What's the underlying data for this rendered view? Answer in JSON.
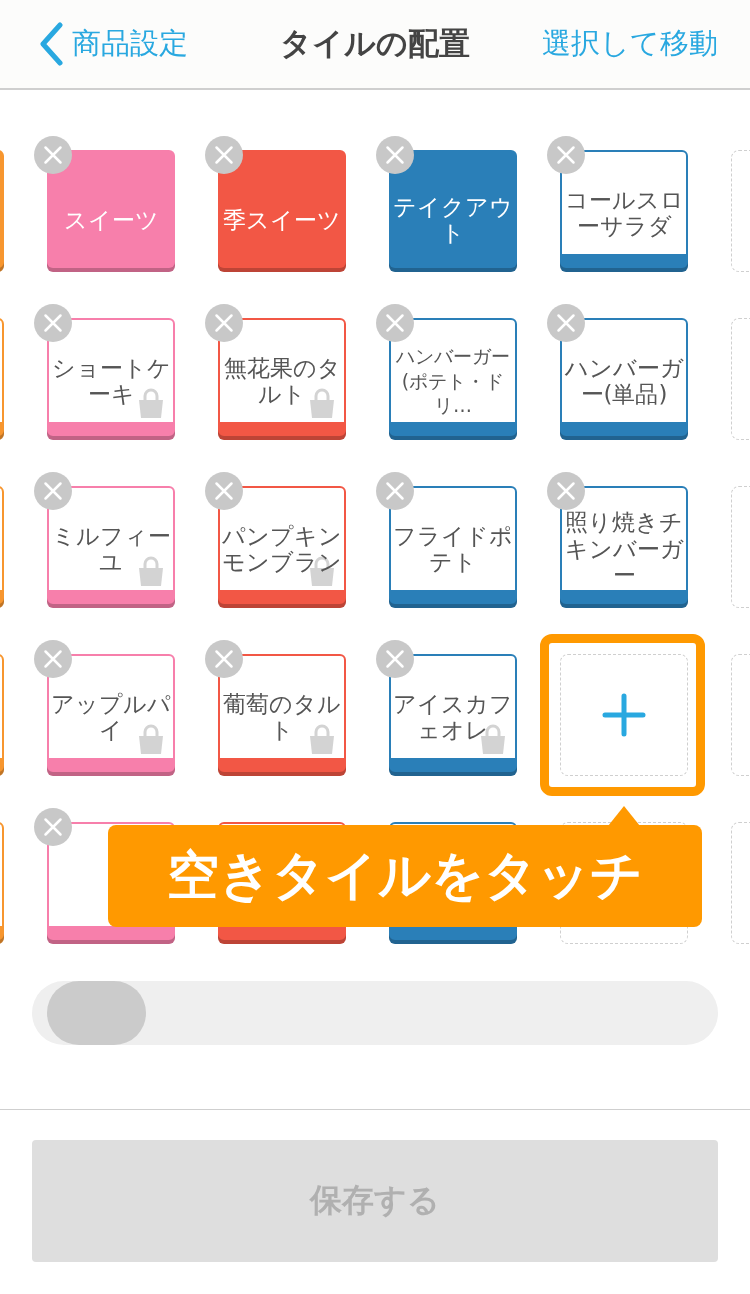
{
  "header": {
    "back_label": "商品設定",
    "title": "タイルの配置",
    "action": "選択して移動"
  },
  "rows": [
    {
      "tiles": [
        {
          "kind": "category",
          "color": "#f7962f",
          "removable": false
        },
        {
          "kind": "category",
          "color": "#f77fab",
          "label": "スイーツ",
          "removable": true
        },
        {
          "kind": "category",
          "color": "#f25745",
          "label": "季スイーツ",
          "removable": true
        },
        {
          "kind": "category",
          "color": "#2a7fb8",
          "label": "テイクアウト",
          "removable": true
        },
        {
          "kind": "product",
          "color": "#2a7fb8",
          "label": "コールスローサラダ",
          "removable": true
        },
        {
          "kind": "empty"
        }
      ]
    },
    {
      "tiles": [
        {
          "kind": "product",
          "color": "#f7962f",
          "removable": false
        },
        {
          "kind": "product",
          "color": "#f77fab",
          "label": "ショートケーキ",
          "bag": true,
          "removable": true
        },
        {
          "kind": "product",
          "color": "#f25745",
          "label": "無花果のタルト",
          "bag": true,
          "removable": true
        },
        {
          "kind": "product",
          "color": "#2a7fb8",
          "label": "ハンバーガー(ポテト・ドリ…",
          "compact": true,
          "removable": true
        },
        {
          "kind": "product",
          "color": "#2a7fb8",
          "label": "ハンバーガー(単品)",
          "removable": true
        },
        {
          "kind": "empty"
        }
      ]
    },
    {
      "tiles": [
        {
          "kind": "product",
          "color": "#f7962f",
          "removable": false
        },
        {
          "kind": "product",
          "color": "#f77fab",
          "label": "ミルフィーユ",
          "bag": true,
          "removable": true
        },
        {
          "kind": "product",
          "color": "#f25745",
          "label": "パンプキンモンブラン",
          "bag": true,
          "removable": true
        },
        {
          "kind": "product",
          "color": "#2a7fb8",
          "label": "フライドポテト",
          "removable": true
        },
        {
          "kind": "product",
          "color": "#2a7fb8",
          "label": "照り焼きチキンバーガー",
          "removable": true
        },
        {
          "kind": "empty"
        }
      ]
    },
    {
      "tiles": [
        {
          "kind": "product",
          "color": "#f7962f",
          "removable": false
        },
        {
          "kind": "product",
          "color": "#f77fab",
          "label": "アップルパイ",
          "bag": true,
          "removable": true
        },
        {
          "kind": "product",
          "color": "#f25745",
          "label": "葡萄のタルト",
          "bag": true,
          "removable": true
        },
        {
          "kind": "product",
          "color": "#2a7fb8",
          "label": "アイスカフェオレ",
          "bag": true,
          "removable": true
        },
        {
          "kind": "empty",
          "highlighted": true
        },
        {
          "kind": "empty"
        }
      ]
    },
    {
      "tiles": [
        {
          "kind": "product",
          "color": "#f7962f",
          "removable": false
        },
        {
          "kind": "product",
          "color": "#f77fab",
          "removable": true
        },
        {
          "kind": "product",
          "color": "#f25745",
          "removable": false
        },
        {
          "kind": "product",
          "color": "#2a7fb8",
          "removable": false
        },
        {
          "kind": "empty"
        },
        {
          "kind": "empty"
        }
      ]
    }
  ],
  "tooltip": "空きタイルをタッチ",
  "save_button": {
    "label": "保存する",
    "disabled": true
  }
}
